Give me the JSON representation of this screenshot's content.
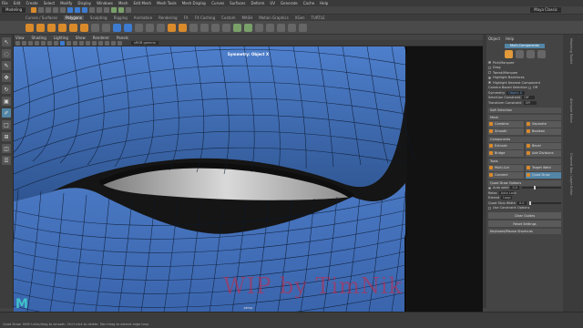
{
  "menubar": {
    "items": [
      "File",
      "Edit",
      "Create",
      "Select",
      "Modify",
      "Display",
      "Windows",
      "Mesh",
      "Edit Mesh",
      "Mesh Tools",
      "Mesh Display",
      "Curves",
      "Surfaces",
      "Deform",
      "UV",
      "Generate",
      "Cache",
      "Help"
    ]
  },
  "status_line": {
    "menuset": "Modeling",
    "workspace": "Maya Classic"
  },
  "shelf_tabs": {
    "items": [
      "Curves / Surfaces",
      "Polygons",
      "Sculpting",
      "Rigging",
      "Animation",
      "Rendering",
      "FX",
      "FX Caching",
      "Custom",
      "MASH",
      "Motion Graphics",
      "XGen",
      "TURTLE"
    ],
    "active": "Polygons"
  },
  "panel": {
    "menus": [
      "View",
      "Shading",
      "Lighting",
      "Show",
      "Renderer",
      "Panels"
    ],
    "gamma": "sRGB gamma"
  },
  "viewport": {
    "title": "Symmetry: Object X",
    "bottom_label": "persp",
    "watermark": "WIP by TimNik"
  },
  "modeling_toolkit": {
    "header_tabs": [
      "Object",
      "Help"
    ],
    "title": "Multi-Components",
    "pick_marquee": "Pick/Marquee",
    "options": [
      {
        "label": "Drag",
        "on": false
      },
      {
        "label": "Tweak/Marquee",
        "on": false
      },
      {
        "label": "Highlight Backfaces",
        "on": true
      },
      {
        "label": "Highlight Nearest Component",
        "on": true
      }
    ],
    "camera_based": "Camera Based Selection",
    "camera_based_value": "Off",
    "symmetry_label": "Symmetry",
    "symmetry_value": "Object X",
    "selection_constraint_label": "Selection Constraint",
    "selection_constraint_value": "Off",
    "transform_constraint_label": "Transform Constraint",
    "transform_constraint_value": "Off",
    "soft_selection": "Soft Selection",
    "sections": {
      "mesh": "Mesh",
      "components": "Components",
      "tools": "Tools"
    },
    "mesh_buttons": [
      "Combine",
      "Separate",
      "Smooth",
      "Boolean"
    ],
    "component_buttons": [
      "Extrude",
      "Bevel",
      "Bridge",
      "Add Divisions"
    ],
    "tool_buttons": [
      "Multi-Cut",
      "Target Weld",
      "Connect",
      "Quad Draw"
    ],
    "active_tool": "Quad Draw",
    "quad_draw_options": "Quad Draw Options",
    "auto_weld_label": "Auto weld",
    "auto_weld_value": "0.0",
    "relax_label": "Relax",
    "relax_value": "Auto Lock",
    "extend_label": "Extend",
    "extend_value": "Loop",
    "quad_strip_label": "Quad Strip Width",
    "quad_strip_value": "0.0",
    "use_constraint": "Use Constraint Options",
    "clear_guides": "Clear Guides",
    "reset_settings": "Reset Settings",
    "keyboard_shortcuts": "Keyboard/Mouse Shortcuts"
  },
  "right_tabs": [
    "Modeling Toolkit",
    "Attribute Editor",
    "Channel Box / Layer Editor"
  ],
  "helpline": {
    "text": "Quad Draw: Shift+click/drag to smooth. Ctrl+click to delete. Tab+drag to extend edge loop."
  },
  "colors": {
    "mesh_fill": "#4a78c2",
    "accent": "#5285a6",
    "watermark": "#c82846",
    "logo": "#3fc2c9"
  }
}
